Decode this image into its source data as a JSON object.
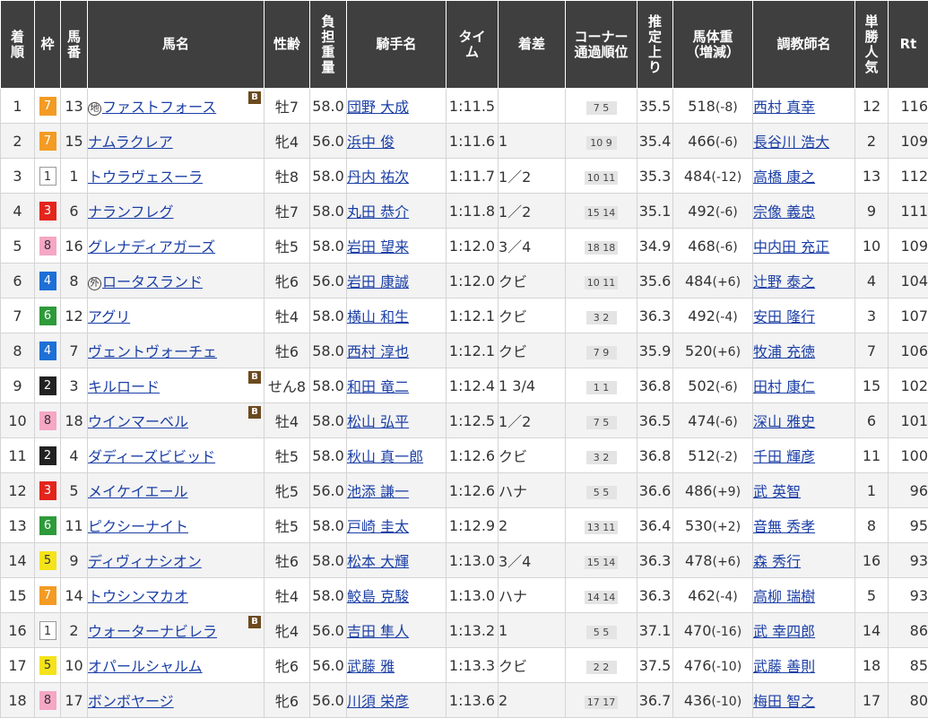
{
  "headers": {
    "rank": [
      "着",
      "順"
    ],
    "waku": [
      "枠"
    ],
    "num": [
      "馬",
      "番"
    ],
    "horse": [
      "馬名"
    ],
    "sexage": [
      "性齢"
    ],
    "weight": [
      "負",
      "担",
      "重",
      "量"
    ],
    "jockey": [
      "騎手名"
    ],
    "time": [
      "タイ",
      "ム"
    ],
    "margin": [
      "着差"
    ],
    "corner": [
      "コーナー",
      "通過順位"
    ],
    "agari": [
      "推",
      "定",
      "上",
      "り"
    ],
    "bodyweight": [
      "馬体重",
      "（増減）"
    ],
    "trainer": [
      "調教師名"
    ],
    "pop": [
      "単",
      "勝",
      "人",
      "気"
    ],
    "rt": [
      "Rt"
    ]
  },
  "rows": [
    {
      "rank": "1",
      "waku": "7",
      "num": "13",
      "mark": "地",
      "horse": "ファストフォース",
      "blinker": "B",
      "sexage": "牡7",
      "weight": "58.0",
      "jockey": "団野 大成",
      "time": "1:11.5",
      "margin": "",
      "corner": "7 5",
      "agari": "35.5",
      "bw": "518",
      "bwdiff": "(-8)",
      "trainer": "西村 真幸",
      "pop": "12",
      "rt": "116"
    },
    {
      "rank": "2",
      "waku": "7",
      "num": "15",
      "mark": "",
      "horse": "ナムラクレア",
      "blinker": "",
      "sexage": "牝4",
      "weight": "56.0",
      "jockey": "浜中 俊",
      "time": "1:11.6",
      "margin": "1",
      "corner": "10 9",
      "agari": "35.4",
      "bw": "466",
      "bwdiff": "(-6)",
      "trainer": "長谷川 浩大",
      "pop": "2",
      "rt": "109"
    },
    {
      "rank": "3",
      "waku": "1",
      "num": "1",
      "mark": "",
      "horse": "トウラヴェスーラ",
      "blinker": "",
      "sexage": "牡8",
      "weight": "58.0",
      "jockey": "丹内 祐次",
      "time": "1:11.7",
      "margin": "1／2",
      "corner": "10 11",
      "agari": "35.3",
      "bw": "484",
      "bwdiff": "(-12)",
      "trainer": "高橋 康之",
      "pop": "13",
      "rt": "112"
    },
    {
      "rank": "4",
      "waku": "3",
      "num": "6",
      "mark": "",
      "horse": "ナランフレグ",
      "blinker": "",
      "sexage": "牡7",
      "weight": "58.0",
      "jockey": "丸田 恭介",
      "time": "1:11.8",
      "margin": "1／2",
      "corner": "15 14",
      "agari": "35.1",
      "bw": "492",
      "bwdiff": "(-6)",
      "trainer": "宗像 義忠",
      "pop": "9",
      "rt": "111"
    },
    {
      "rank": "5",
      "waku": "8",
      "num": "16",
      "mark": "",
      "horse": "グレナディアガーズ",
      "blinker": "",
      "sexage": "牡5",
      "weight": "58.0",
      "jockey": "岩田 望来",
      "time": "1:12.0",
      "margin": "3／4",
      "corner": "18 18",
      "agari": "34.9",
      "bw": "468",
      "bwdiff": "(-6)",
      "trainer": "中内田 充正",
      "pop": "10",
      "rt": "109"
    },
    {
      "rank": "6",
      "waku": "4",
      "num": "8",
      "mark": "外",
      "horse": "ロータスランド",
      "blinker": "",
      "sexage": "牝6",
      "weight": "56.0",
      "jockey": "岩田 康誠",
      "time": "1:12.0",
      "margin": "クビ",
      "corner": "10 11",
      "agari": "35.6",
      "bw": "484",
      "bwdiff": "(+6)",
      "trainer": "辻野 泰之",
      "pop": "4",
      "rt": "104"
    },
    {
      "rank": "7",
      "waku": "6",
      "num": "12",
      "mark": "",
      "horse": "アグリ",
      "blinker": "",
      "sexage": "牡4",
      "weight": "58.0",
      "jockey": "横山 和生",
      "time": "1:12.1",
      "margin": "クビ",
      "corner": "3 2",
      "agari": "36.3",
      "bw": "492",
      "bwdiff": "(-4)",
      "trainer": "安田 隆行",
      "pop": "3",
      "rt": "107"
    },
    {
      "rank": "8",
      "waku": "4",
      "num": "7",
      "mark": "",
      "horse": "ヴェントヴォーチェ",
      "blinker": "",
      "sexage": "牡6",
      "weight": "58.0",
      "jockey": "西村 淳也",
      "time": "1:12.1",
      "margin": "クビ",
      "corner": "7 9",
      "agari": "35.9",
      "bw": "520",
      "bwdiff": "(+6)",
      "trainer": "牧浦 充徳",
      "pop": "7",
      "rt": "106"
    },
    {
      "rank": "9",
      "waku": "2",
      "num": "3",
      "mark": "",
      "horse": "キルロード",
      "blinker": "B",
      "sexage": "せん8",
      "weight": "58.0",
      "jockey": "和田 竜二",
      "time": "1:12.4",
      "margin": "1 3/4",
      "corner": "1 1",
      "agari": "36.8",
      "bw": "502",
      "bwdiff": "(-6)",
      "trainer": "田村 康仁",
      "pop": "15",
      "rt": "102"
    },
    {
      "rank": "10",
      "waku": "8",
      "num": "18",
      "mark": "",
      "horse": "ウインマーベル",
      "blinker": "B",
      "sexage": "牡4",
      "weight": "58.0",
      "jockey": "松山 弘平",
      "time": "1:12.5",
      "margin": "1／2",
      "corner": "7 5",
      "agari": "36.5",
      "bw": "474",
      "bwdiff": "(-6)",
      "trainer": "深山 雅史",
      "pop": "6",
      "rt": "101"
    },
    {
      "rank": "11",
      "waku": "2",
      "num": "4",
      "mark": "",
      "horse": "ダディーズビビッド",
      "blinker": "",
      "sexage": "牡5",
      "weight": "58.0",
      "jockey": "秋山 真一郎",
      "time": "1:12.6",
      "margin": "クビ",
      "corner": "3 2",
      "agari": "36.8",
      "bw": "512",
      "bwdiff": "(-2)",
      "trainer": "千田 輝彦",
      "pop": "11",
      "rt": "100"
    },
    {
      "rank": "12",
      "waku": "3",
      "num": "5",
      "mark": "",
      "horse": "メイケイエール",
      "blinker": "",
      "sexage": "牝5",
      "weight": "56.0",
      "jockey": "池添 謙一",
      "time": "1:12.6",
      "margin": "ハナ",
      "corner": "5 5",
      "agari": "36.6",
      "bw": "486",
      "bwdiff": "(+9)",
      "trainer": "武 英智",
      "pop": "1",
      "rt": "96"
    },
    {
      "rank": "13",
      "waku": "6",
      "num": "11",
      "mark": "",
      "horse": "ピクシーナイト",
      "blinker": "",
      "sexage": "牡5",
      "weight": "58.0",
      "jockey": "戸崎 圭太",
      "time": "1:12.9",
      "margin": "2",
      "corner": "13 11",
      "agari": "36.4",
      "bw": "530",
      "bwdiff": "(+2)",
      "trainer": "音無 秀孝",
      "pop": "8",
      "rt": "95"
    },
    {
      "rank": "14",
      "waku": "5",
      "num": "9",
      "mark": "",
      "horse": "ディヴィナシオン",
      "blinker": "",
      "sexage": "牡6",
      "weight": "58.0",
      "jockey": "松本 大輝",
      "time": "1:13.0",
      "margin": "3／4",
      "corner": "15 14",
      "agari": "36.3",
      "bw": "478",
      "bwdiff": "(+6)",
      "trainer": "森 秀行",
      "pop": "16",
      "rt": "93"
    },
    {
      "rank": "15",
      "waku": "7",
      "num": "14",
      "mark": "",
      "horse": "トウシンマカオ",
      "blinker": "",
      "sexage": "牡4",
      "weight": "58.0",
      "jockey": "鮫島 克駿",
      "time": "1:13.0",
      "margin": "ハナ",
      "corner": "14 14",
      "agari": "36.3",
      "bw": "462",
      "bwdiff": "(-4)",
      "trainer": "高柳 瑞樹",
      "pop": "5",
      "rt": "93"
    },
    {
      "rank": "16",
      "waku": "1",
      "num": "2",
      "mark": "",
      "horse": "ウォーターナビレラ",
      "blinker": "B",
      "sexage": "牝4",
      "weight": "56.0",
      "jockey": "吉田 隼人",
      "time": "1:13.2",
      "margin": "1",
      "corner": "5 5",
      "agari": "37.1",
      "bw": "470",
      "bwdiff": "(-16)",
      "trainer": "武 幸四郎",
      "pop": "14",
      "rt": "86"
    },
    {
      "rank": "17",
      "waku": "5",
      "num": "10",
      "mark": "",
      "horse": "オパールシャルム",
      "blinker": "",
      "sexage": "牝6",
      "weight": "56.0",
      "jockey": "武藤 雅",
      "time": "1:13.3",
      "margin": "クビ",
      "corner": "2 2",
      "agari": "37.5",
      "bw": "476",
      "bwdiff": "(-10)",
      "trainer": "武藤 善則",
      "pop": "18",
      "rt": "85"
    },
    {
      "rank": "18",
      "waku": "8",
      "num": "17",
      "mark": "",
      "horse": "ボンボヤージ",
      "blinker": "",
      "sexage": "牝6",
      "weight": "56.0",
      "jockey": "川須 栄彦",
      "time": "1:13.6",
      "margin": "2",
      "corner": "17 17",
      "agari": "36.7",
      "bw": "436",
      "bwdiff": "(-10)",
      "trainer": "梅田 智之",
      "pop": "17",
      "rt": "80"
    }
  ]
}
